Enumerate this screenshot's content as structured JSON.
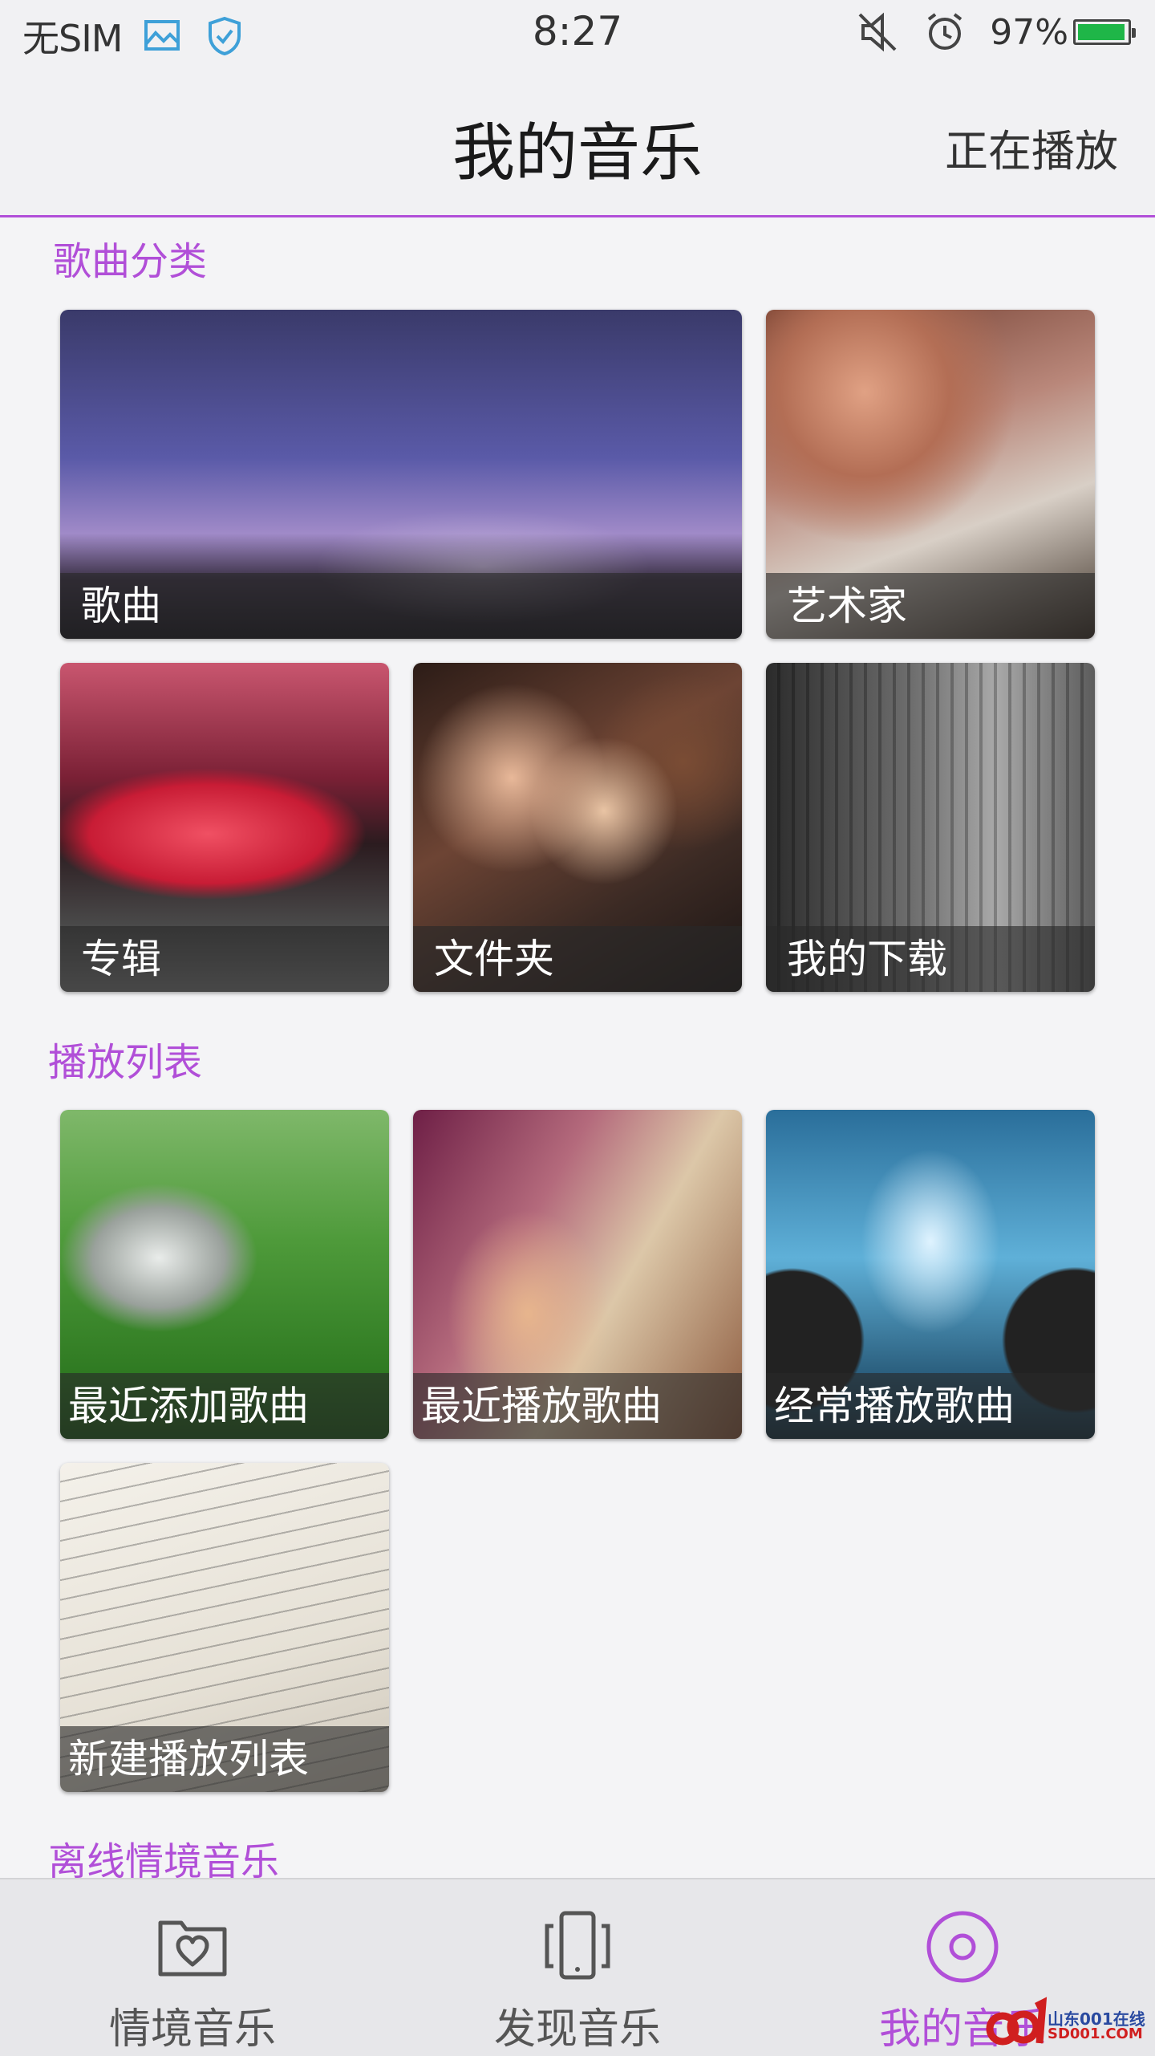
{
  "status_bar": {
    "carrier": "无SIM",
    "time": "8:27",
    "battery_percent": "97%",
    "battery_level": 0.97,
    "icons": [
      "gallery-icon",
      "shield-icon",
      "mute-icon",
      "alarm-icon",
      "battery-icon"
    ]
  },
  "header": {
    "title": "我的音乐",
    "now_playing": "正在播放"
  },
  "sections": {
    "categories": {
      "title": "歌曲分类",
      "tiles": [
        "歌曲",
        "艺术家",
        "专辑",
        "文件夹",
        "我的下载"
      ]
    },
    "playlists": {
      "title": "播放列表",
      "tiles": [
        "最近添加歌曲",
        "最近播放歌曲",
        "经常播放歌曲",
        "新建播放列表"
      ]
    },
    "offline": {
      "title": "离线情境音乐"
    }
  },
  "bottom_nav": {
    "items": [
      {
        "label": "情境音乐",
        "icon": "folder-heart-icon"
      },
      {
        "label": "发现音乐",
        "icon": "phone-discover-icon"
      },
      {
        "label": "我的音乐",
        "icon": "disc-icon",
        "active": true
      }
    ]
  },
  "watermark": {
    "line1": "山东001在线",
    "line2": "SD001.COM"
  },
  "colors": {
    "accent": "#b14fd8",
    "battery": "#1fb648"
  }
}
